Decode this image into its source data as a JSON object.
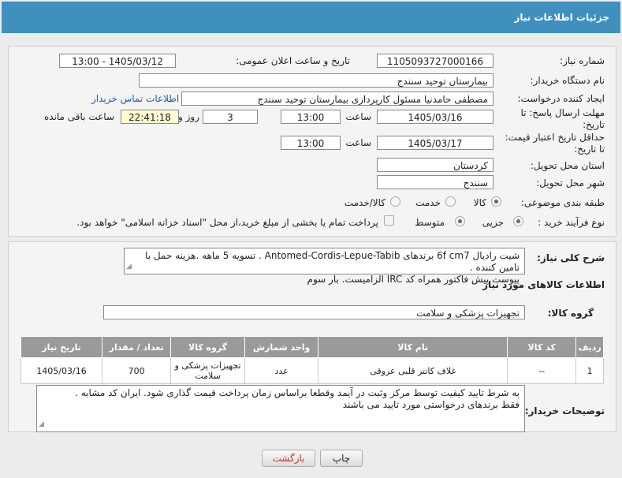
{
  "page_title": "جزئیات اطلاعات نیاز",
  "fields": {
    "need_number_label": "شماره نیاز:",
    "need_number": "1105093727000166",
    "announce_label": "تاریخ و ساعت اعلان عمومی:",
    "announce_value": "1405/03/12 - 13:00",
    "buyer_org_label": "نام دستگاه خریدار:",
    "buyer_org": "بیمارستان توحید سنندج",
    "requester_label": "ایجاد کننده درخواست:",
    "requester": "مصطفی حامدنیا مسئول کارپردازی بیمارستان توحید سنندج",
    "contact_link": "اطلاعات تماس خریدار",
    "reply_deadline_label_1": "مهلت ارسال پاسخ: تا",
    "reply_deadline_label_2": "تاریخ:",
    "reply_date": "1405/03/16",
    "time_label": "ساعت",
    "reply_time": "13:00",
    "days_value": "3",
    "days_label": "روز و",
    "remaining_time": "22:41:18",
    "remaining_label": "ساعت باقی مانده",
    "validity_label_1": "حداقل تاریخ اعتبار قیمت:",
    "validity_label_2": "تا تاریخ:",
    "validity_date": "1405/03/17",
    "validity_time": "13:00",
    "province_label": "استان محل تحویل:",
    "province": "کردستان",
    "city_label": "شهر محل تحویل:",
    "city": "سنندج",
    "category_label": "طبقه بندی موضوعی:",
    "category_options": [
      "کالا",
      "خدمت",
      "کالا/خدمت"
    ],
    "process_label": "نوع فرآیند خرید :",
    "process_options": [
      "جزیی",
      "متوسط"
    ],
    "payment_note": "پرداخت تمام یا بخشی از مبلغ خرید،از محل \"اسناد خزانه اسلامی\" خواهد بود."
  },
  "summary": {
    "label": "شرح کلی نیاز:",
    "line1": "شیت رادیال 6f cm7 برندهای Antomed-Cordis-Lepue-Tabib . تسویه 5 ماهه .هزینه حمل با تامین کننده .",
    "line2": "پیوست پیش فاکتور همراه کد IRC  الزامیست. بار سوم"
  },
  "goods_section_title": "اطلاعات کالاهای مورد نیاز",
  "goods_group_label": "گروه کالا:",
  "goods_group": "تجهیزات پزشکی و سلامت",
  "table": {
    "headers": [
      "ردیف",
      "کد کالا",
      "نام کالا",
      "واحد شمارش",
      "گروه کالا",
      "تعداد / مقدار",
      "تاریخ نیاز"
    ],
    "rows": [
      [
        "1",
        "--",
        "غلاف کاتتر قلبی عروقی",
        "عدد",
        "تجهیزات پزشکی و سلامت",
        "700",
        "1405/03/16"
      ]
    ]
  },
  "buyer_notes": {
    "label": "توضیحات خریدار:",
    "line1": "به شرط تایید کیفیت توسط مرکز وثبت در آیمد وقطعا براساس زمان پرداخت  قیمت گذاری شود. ایران کد مشابه .",
    "line2": "فقط برندهای درخواستی مورد تایید می باشند"
  },
  "buttons": {
    "print": "چاپ",
    "back": "بازگشت"
  }
}
